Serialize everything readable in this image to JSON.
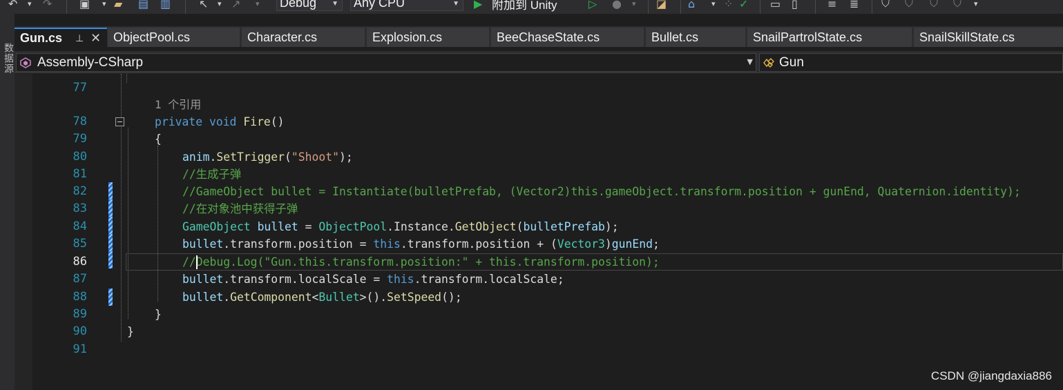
{
  "toolbar": {
    "config": "Debug",
    "platform": "Any CPU",
    "attach_label": "附加到 Unity"
  },
  "leftstrip_label": "数据源",
  "tabs": [
    {
      "label": "Gun.cs"
    },
    {
      "label": "ObjectPool.cs"
    },
    {
      "label": "Character.cs"
    },
    {
      "label": "Explosion.cs"
    },
    {
      "label": "BeeChaseState.cs"
    },
    {
      "label": "Bullet.cs"
    },
    {
      "label": "SnailPartrolState.cs"
    },
    {
      "label": "SnailSkillState.cs"
    }
  ],
  "navbar": {
    "project": "Assembly-CSharp",
    "class": "Gun"
  },
  "code": {
    "codelens": "1 个引用",
    "lines": [
      {
        "n": "77"
      },
      {
        "n": "78"
      },
      {
        "n": "79"
      },
      {
        "n": "80"
      },
      {
        "n": "81"
      },
      {
        "n": "82"
      },
      {
        "n": "83"
      },
      {
        "n": "84"
      },
      {
        "n": "85"
      },
      {
        "n": "86"
      },
      {
        "n": "87"
      },
      {
        "n": "88"
      },
      {
        "n": "89"
      },
      {
        "n": "90"
      },
      {
        "n": "91"
      }
    ],
    "t": {
      "private": "private",
      "void": "void",
      "fire": "Fire",
      "parens": "()",
      "open_brace": "{",
      "close_brace": "}",
      "anim": "anim",
      "dot": ".",
      "setTrigger": "SetTrigger",
      "lp": "(",
      "rp": ")",
      "shoot": "\"Shoot\"",
      "semi": ";",
      "comment81": "//生成子弹",
      "comment82": "//GameObject bullet = Instantiate(bulletPrefab, (Vector2)this.gameObject.transform.position + gunEnd, Quaternion.identity);",
      "comment83": "//在对象池中获得子弹",
      "gameObject": "GameObject",
      "bullet": "bullet",
      "eq": " = ",
      "objectPool": "ObjectPool",
      "instance": "Instance",
      "getObject": "GetObject",
      "bulletPrefab": "bulletPrefab",
      "transform": "transform",
      "position": "position",
      "this": "this",
      "plus": " + ",
      "vector3": "Vector3",
      "gunEnd": "gunEnd",
      "comment86": "//Debug.Log(\"Gun.this.transform.position:\" + this.transform.position);",
      "localScale": "localScale",
      "getComponent": "GetComponent",
      "lt": "<",
      "gt": ">",
      "bulletType": "Bullet",
      "setSpeed": "SetSpeed",
      "space": " "
    }
  },
  "watermark": "CSDN @jiangdaxia886",
  "colors": {
    "keyword": "#569cd6",
    "type": "#4ec9b0",
    "method": "#dcdcaa",
    "string": "#d69d85",
    "comment": "#57a64a",
    "line_number": "#2b91af",
    "accent": "#3d8ee3",
    "change_marker": "#1f73d8"
  }
}
